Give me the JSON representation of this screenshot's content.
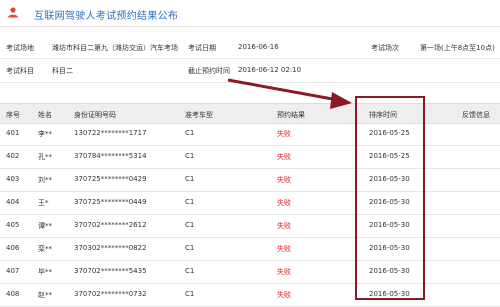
{
  "header": {
    "title": "互联网驾驶人考试预约结果公布",
    "icon": "person-icon",
    "accent": "#2a6fc0"
  },
  "info": {
    "venue_label": "考试场地",
    "venue_value": "潍坊市科目二第九（潍坊交运）汽车考场",
    "date_label": "考试日期",
    "date_value": "2016-06-16",
    "session_label": "考试场次",
    "session_value": "第一场(上午8点至10点)",
    "subject_label": "考试科目",
    "subject_value": "科目二",
    "deadline_label": "截止预约时间",
    "deadline_value": "2016-06-12 02:10"
  },
  "table": {
    "headers": [
      "序号",
      "姓名",
      "身份证明号码",
      "准考车型",
      "预约结果",
      "排序时间",
      "反馈信息"
    ],
    "rows": [
      [
        "401",
        "李**",
        "130722********1717",
        "C1",
        "失败",
        "2016-05-25",
        ""
      ],
      [
        "402",
        "孔**",
        "370784********5314",
        "C1",
        "失败",
        "2016-05-25",
        ""
      ],
      [
        "403",
        "刘**",
        "370725********0429",
        "C1",
        "失败",
        "2016-05-30",
        ""
      ],
      [
        "404",
        "王*",
        "370725********0449",
        "C1",
        "失败",
        "2016-05-30",
        ""
      ],
      [
        "405",
        "谭**",
        "370702********2612",
        "C1",
        "失败",
        "2016-05-30",
        ""
      ],
      [
        "406",
        "栾**",
        "370302********0822",
        "C1",
        "失败",
        "2016-05-30",
        ""
      ],
      [
        "407",
        "毕**",
        "370702********5435",
        "C1",
        "失败",
        "2016-05-30",
        ""
      ],
      [
        "408",
        "赵**",
        "370702********0732",
        "C1",
        "失败",
        "2016-05-30",
        ""
      ]
    ],
    "fail_color": "#e02020"
  },
  "annotation": {
    "box_color": "#8b1a24",
    "arrow_color": "#8b1a24"
  }
}
